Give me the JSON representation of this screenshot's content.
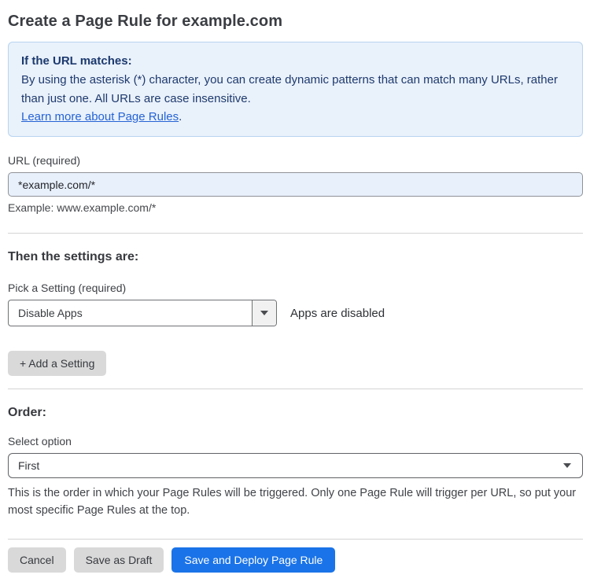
{
  "page": {
    "title": "Create a Page Rule for example.com"
  },
  "info_box": {
    "heading": "If the URL matches:",
    "body": "By using the asterisk (*) character, you can create dynamic patterns that can match many URLs, rather than just one. All URLs are case insensitive.",
    "link_label": "Learn more about Page Rules",
    "link_suffix": "."
  },
  "url_field": {
    "label": "URL (required)",
    "value": "*example.com/*",
    "helper": "Example: www.example.com/*"
  },
  "settings_section": {
    "heading": "Then the settings are:",
    "picker_label": "Pick a Setting (required)",
    "selected_setting": "Disable Apps",
    "status_text": "Apps are disabled",
    "add_button_label": "+ Add a Setting"
  },
  "order_section": {
    "heading": "Order:",
    "select_label": "Select option",
    "selected_option": "First",
    "helper": "This is the order in which your Page Rules will be triggered. Only one Page Rule will trigger per URL, so put your most specific Page Rules at the top."
  },
  "footer": {
    "cancel_label": "Cancel",
    "save_draft_label": "Save as Draft",
    "save_deploy_label": "Save and Deploy Page Rule"
  },
  "colors": {
    "info_bg": "#e9f1fb",
    "info_border": "#b8d4ef",
    "info_text": "#1e3a6d",
    "link_blue": "#2563d4",
    "input_bg": "#e8f0fb",
    "primary_button_blue": "#1a73e8",
    "gray_button": "#d9d9d9"
  }
}
